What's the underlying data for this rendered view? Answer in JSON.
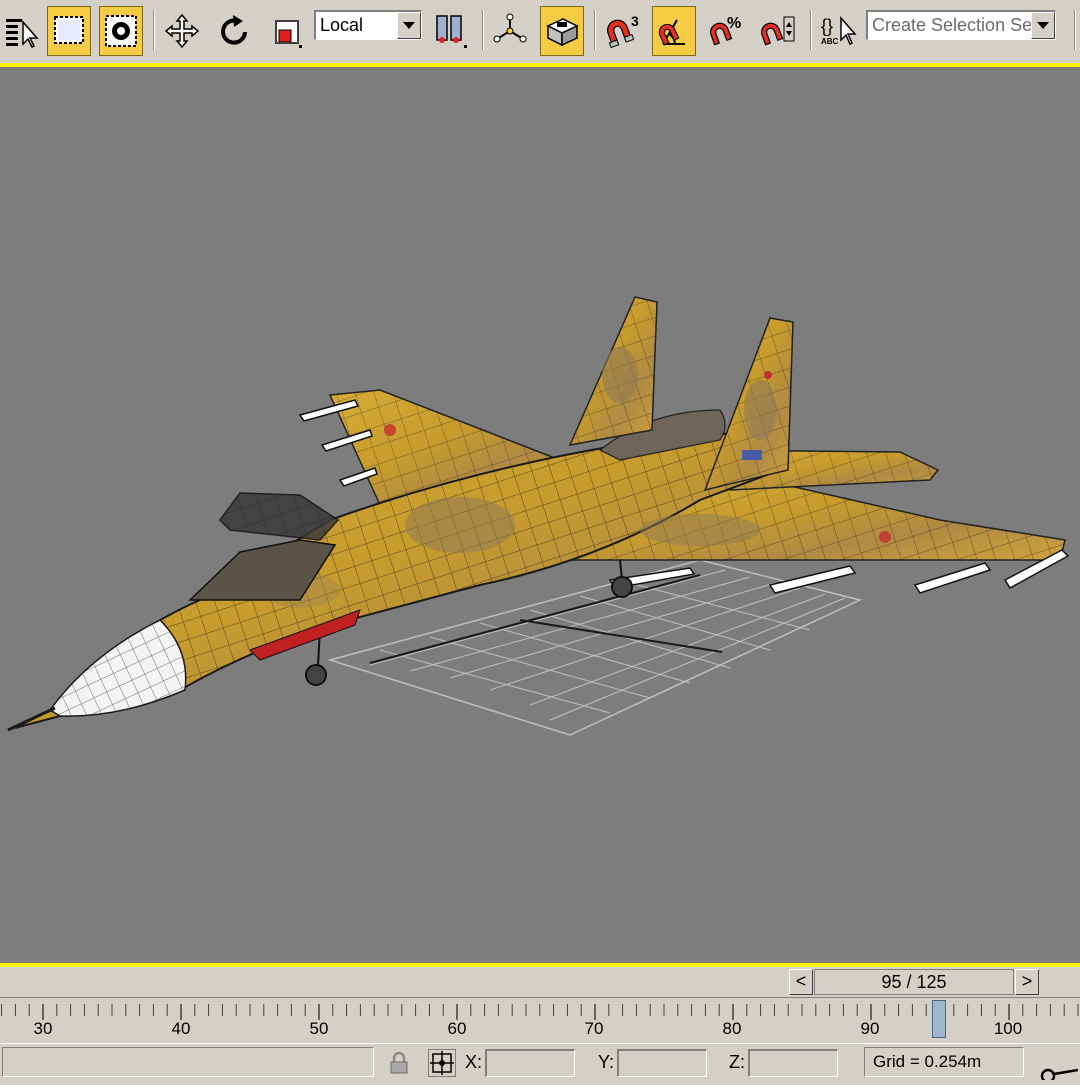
{
  "toolbar": {
    "reference_coordinate_system": "Local",
    "selection_set_placeholder": "Create Selection Set",
    "snap_angle_superscript": "3",
    "percent_snap_glyph": "%",
    "edit_named_sets_caption": "ABC",
    "active_tools": [
      "select-by-region",
      "select-object",
      "manipulate",
      "angle-snap"
    ],
    "icons": [
      "select-by-name-icon",
      "rectangular-region-icon",
      "select-object-icon",
      "move-icon",
      "rotate-icon",
      "scale-icon",
      "use-pivot-center-icon",
      "select-manipulate-icon",
      "keyboard-shortcut-override-icon",
      "snaps-toggle-icon",
      "angle-snap-icon",
      "percent-snap-icon",
      "spinner-snap-icon",
      "edit-named-selection-sets-icon"
    ],
    "accent_color": "#fff200",
    "active_color": "#f5cb44"
  },
  "viewport": {
    "background_color": "#7d7d7d",
    "grid_color": "#bfbfbf",
    "model_base_color": "#c79b2c"
  },
  "time_slider": {
    "frame_display": "95 / 125",
    "prev_label": "<",
    "next_label": ">",
    "current_frame": 95,
    "total_frames": 125
  },
  "trackbar": {
    "tick_labels": [
      "30",
      "40",
      "50",
      "60",
      "70",
      "80",
      "90",
      "100"
    ],
    "marker_color": "#9fb6cc"
  },
  "status_bar": {
    "x_label": "X:",
    "y_label": "Y:",
    "z_label": "Z:",
    "x_value": "",
    "y_value": "",
    "z_value": "",
    "grid_readout": "Grid = 0.254m"
  }
}
